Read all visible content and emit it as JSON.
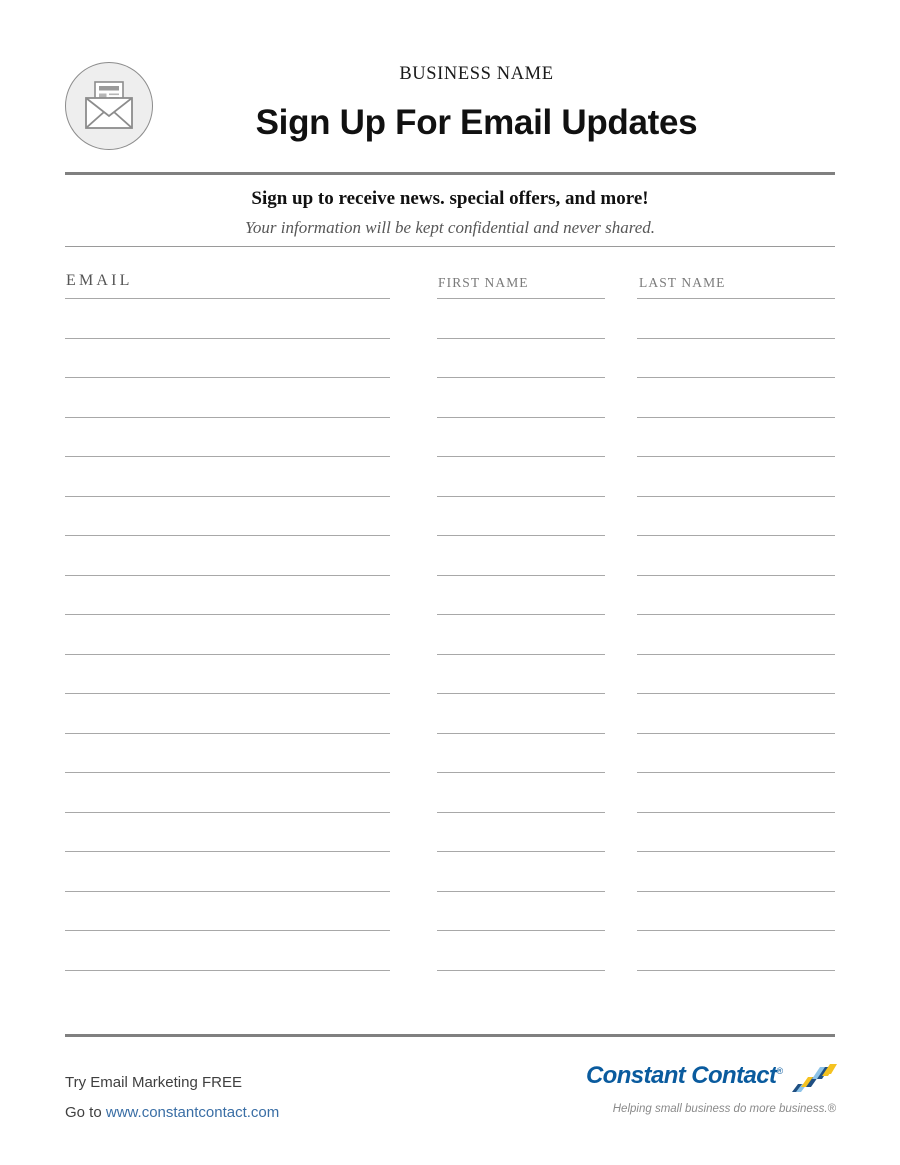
{
  "document": {
    "type": "email-signup-sheet",
    "page_background": "#ffffff"
  },
  "header": {
    "logo_icon": "open-envelope-with-letter-icon",
    "business_name": "BUSINESS NAME",
    "title": "Sign Up For Email Updates"
  },
  "subhead": {
    "headline": "Sign up to receive news. special offers, and more!",
    "privacy_note": "Your information will be kept confidential and never shared."
  },
  "form": {
    "columns": [
      {
        "key": "email",
        "label": "EMAIL"
      },
      {
        "key": "first_name",
        "label": "FIRST NAME"
      },
      {
        "key": "last_name",
        "label": "LAST NAME"
      }
    ],
    "row_count": 18,
    "rows": [
      {
        "email": "",
        "first_name": "",
        "last_name": ""
      },
      {
        "email": "",
        "first_name": "",
        "last_name": ""
      },
      {
        "email": "",
        "first_name": "",
        "last_name": ""
      },
      {
        "email": "",
        "first_name": "",
        "last_name": ""
      },
      {
        "email": "",
        "first_name": "",
        "last_name": ""
      },
      {
        "email": "",
        "first_name": "",
        "last_name": ""
      },
      {
        "email": "",
        "first_name": "",
        "last_name": ""
      },
      {
        "email": "",
        "first_name": "",
        "last_name": ""
      },
      {
        "email": "",
        "first_name": "",
        "last_name": ""
      },
      {
        "email": "",
        "first_name": "",
        "last_name": ""
      },
      {
        "email": "",
        "first_name": "",
        "last_name": ""
      },
      {
        "email": "",
        "first_name": "",
        "last_name": ""
      },
      {
        "email": "",
        "first_name": "",
        "last_name": ""
      },
      {
        "email": "",
        "first_name": "",
        "last_name": ""
      },
      {
        "email": "",
        "first_name": "",
        "last_name": ""
      },
      {
        "email": "",
        "first_name": "",
        "last_name": ""
      },
      {
        "email": "",
        "first_name": "",
        "last_name": ""
      },
      {
        "email": "",
        "first_name": "",
        "last_name": ""
      }
    ]
  },
  "footer": {
    "promo_line1": "Try Email Marketing FREE",
    "promo_line2_prefix": "Go to ",
    "promo_link": "www.constantcontact.com",
    "brand_name": "Constant Contact",
    "brand_trademark": "®",
    "brand_tagline": "Helping small business do more business.®",
    "brand_logo_icon": "constant-contact-chevron-mark-icon"
  },
  "colors": {
    "rule_heavy": "#808080",
    "rule_light": "#a8a8a8",
    "text_dark": "#111111",
    "text_muted": "#7a7a7a",
    "link_blue": "#3a6ea5",
    "brand_blue": "#0a5b9e",
    "brand_blue_dark": "#1f4f82",
    "brand_gold": "#f5c220",
    "brand_light_blue": "#8dc3e8"
  }
}
